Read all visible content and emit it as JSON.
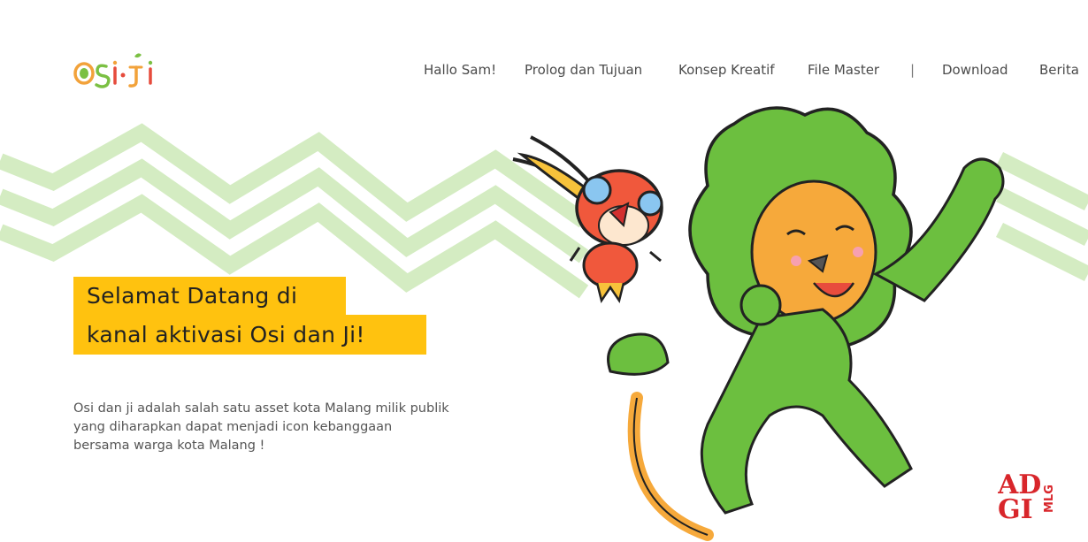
{
  "brand": {
    "logo_text": "OSI·JI"
  },
  "nav": {
    "items": [
      "Hallo Sam!",
      "Prolog dan Tujuan",
      "Konsep Kreatif",
      "File Master",
      "|",
      "Download",
      "Berita"
    ]
  },
  "hero": {
    "title_line1": "Selamat Datang di",
    "title_line2": "kanal aktivasi Osi dan Ji!",
    "description": [
      "Osi dan ji adalah salah satu asset kota Malang milik publik",
      "yang diharapkan dapat menjadi icon kebanggaan",
      "bersama warga kota Malang !"
    ]
  },
  "footer_badge": {
    "main": "ADGI",
    "sub": "MLG"
  },
  "colors": {
    "accent_yellow": "#ffc20f",
    "zigzag_green": "#d4ecc2",
    "mascot_green": "#6cbf3f",
    "mascot_orange": "#f6a93b",
    "badge_red": "#d8262b"
  },
  "icons": {
    "logo": "osiji-logo",
    "bird_mascot": "osi-bird-icon",
    "lion_mascot": "ji-lion-icon",
    "apdi_badge": "adgi-mlg-logo"
  }
}
